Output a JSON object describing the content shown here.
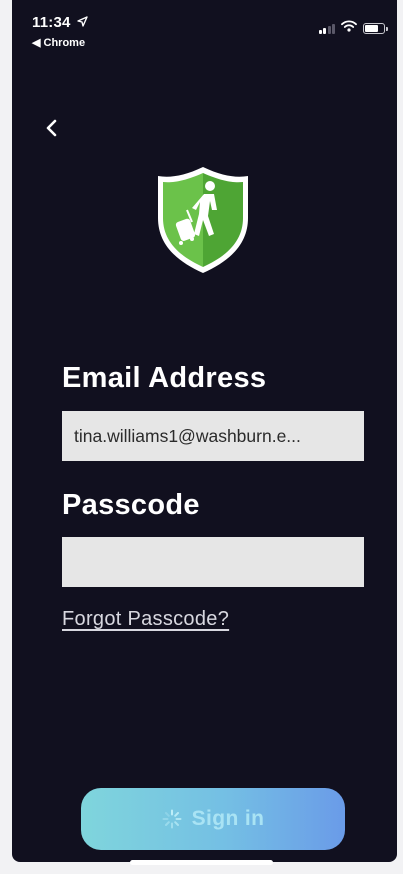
{
  "status_bar": {
    "time": "11:34",
    "back_app": "◀ Chrome",
    "battery_level": 0.8,
    "signal_bars": 4,
    "signal_bars_active": 2
  },
  "nav": {
    "back_icon": "chevron-left-icon"
  },
  "logo": {
    "icon": "shield-traveler-icon",
    "colors": {
      "shield_left": "#6bc24a",
      "shield_right": "#4ea534",
      "border": "#ffffff"
    }
  },
  "form": {
    "email_label": "Email Address",
    "email_value": "tina.williams1@washburn.e...",
    "passcode_label": "Passcode",
    "passcode_value": "",
    "forgot_label": "Forgot Passcode?"
  },
  "sign_in": {
    "label": "Sign in",
    "loading": true,
    "spinner_icon": "loading-spinner-icon"
  },
  "colors": {
    "background": "#11101f",
    "input_bg": "#e6e6e6",
    "button_start": "#7fd5dc",
    "button_end": "#6a9be8"
  }
}
